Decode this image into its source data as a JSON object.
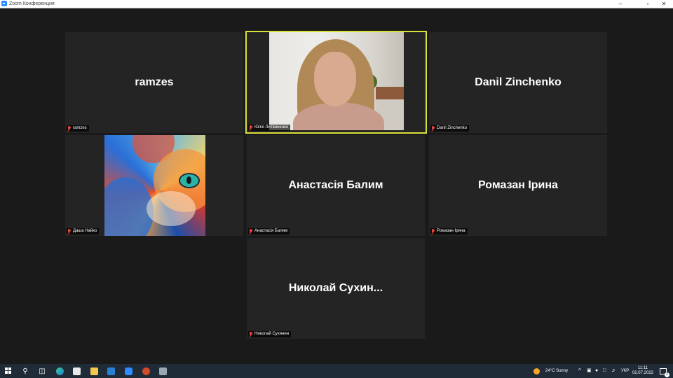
{
  "window": {
    "title": "Zoom Конференция",
    "minimize": "–",
    "maximize": "▫",
    "close": "✕"
  },
  "participants": [
    {
      "display": "ramzes",
      "tag": "ramzes",
      "muted": true
    },
    {
      "display": "",
      "tag": "Юлія Литвиненко",
      "muted": true,
      "video": true,
      "speaking": true
    },
    {
      "display": "Danil Zinchenko",
      "tag": "Danil Zinchenko",
      "muted": true
    },
    {
      "display": "",
      "tag": "Даша Найко",
      "muted": true,
      "picture": true
    },
    {
      "display": "Анастасія Балим",
      "tag": "Анастасія Балим",
      "muted": true
    },
    {
      "display": "Ромазан Ірина",
      "tag": "Ромазан Ірина",
      "muted": true
    },
    {
      "display": "Николай  Сухин...",
      "tag": "Николай Сухинин",
      "muted": true
    }
  ],
  "taskbar": {
    "weather": "24°C  Sunny",
    "language": "УКР",
    "time": "11:11",
    "date": "02.07.2022",
    "notifications": "2"
  },
  "colors": {
    "speaker_border": "#d9e03b",
    "tile_bg": "#242424",
    "muted_icon": "#e8453c"
  }
}
